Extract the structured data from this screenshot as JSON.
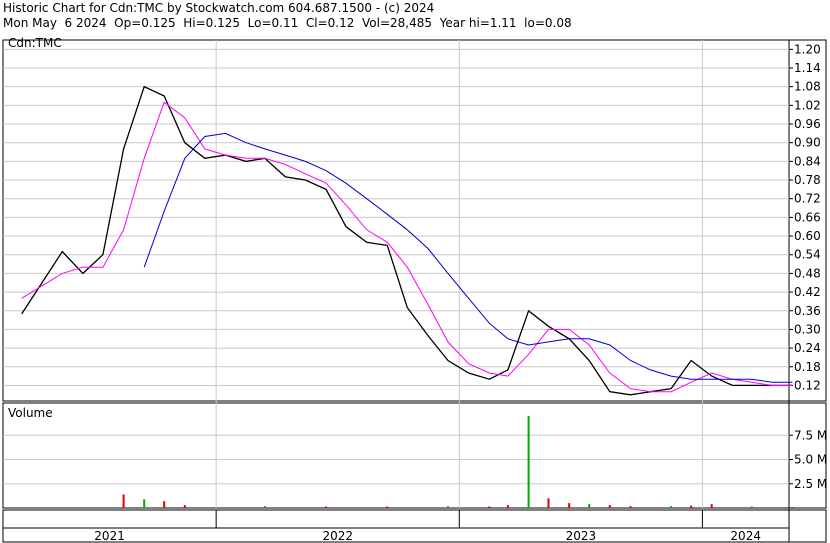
{
  "header": {
    "line1": "Historic Chart for Cdn:TMC by Stockwatch.com 604.687.1500 - (c) 2024",
    "line2": "Mon May  6 2024  Op=0.125  Hi=0.125  Lo=0.11  Cl=0.12  Vol=28,485  Year hi=1.11  lo=0.08"
  },
  "colors": {
    "price_bars": "#000000",
    "ma_short": "#ff00ff",
    "ma_long": "#0000cc",
    "volume_up": "#00aa00",
    "volume_down": "#dd0000",
    "grid": "#c8c8c8"
  },
  "chart_data": [
    {
      "type": "line",
      "label": "Cdn:TMC",
      "y_tick_labels": [
        "1.20",
        "1.14",
        "1.08",
        "1.02",
        "0.96",
        "0.90",
        "0.84",
        "0.78",
        "0.72",
        "0.66",
        "0.60",
        "0.54",
        "0.48",
        "0.42",
        "0.36",
        "0.30",
        "0.24",
        "0.18",
        "0.12"
      ],
      "ylim": [
        0.07,
        1.23
      ],
      "grid": true,
      "x": [
        "2021-03",
        "2021-05",
        "2021-06",
        "2021-07",
        "2021-08",
        "2021-09",
        "2021-10",
        "2021-11",
        "2021-12",
        "2022-01",
        "2022-02",
        "2022-03",
        "2022-04",
        "2022-05",
        "2022-06",
        "2022-07",
        "2022-08",
        "2022-09",
        "2022-10",
        "2022-11",
        "2022-12",
        "2023-01",
        "2023-02",
        "2023-03",
        "2023-04",
        "2023-05",
        "2023-06",
        "2023-07",
        "2023-08",
        "2023-09",
        "2023-10",
        "2023-11",
        "2023-12",
        "2024-01",
        "2024-02",
        "2024-03",
        "2024-04",
        "2024-05"
      ],
      "series": [
        {
          "values": [
            0.35,
            0.55,
            0.48,
            0.54,
            0.88,
            1.08,
            1.05,
            0.9,
            0.85,
            0.86,
            0.84,
            0.85,
            0.79,
            0.78,
            0.75,
            0.63,
            0.58,
            0.57,
            0.37,
            0.28,
            0.2,
            0.16,
            0.14,
            0.17,
            0.36,
            0.31,
            0.27,
            0.2,
            0.1,
            0.09,
            0.1,
            0.11,
            0.2,
            0.15,
            0.12,
            0.12,
            0.12,
            0.12
          ]
        },
        {
          "values": [
            0.4,
            0.48,
            0.5,
            0.5,
            0.62,
            0.85,
            1.03,
            0.98,
            0.88,
            0.86,
            0.85,
            0.85,
            0.83,
            0.8,
            0.77,
            0.7,
            0.62,
            0.58,
            0.5,
            0.38,
            0.26,
            0.19,
            0.16,
            0.15,
            0.22,
            0.3,
            0.3,
            0.25,
            0.16,
            0.11,
            0.1,
            0.1,
            0.13,
            0.16,
            0.14,
            0.13,
            0.12,
            0.12
          ]
        },
        {
          "values": [
            null,
            null,
            null,
            null,
            null,
            0.5,
            0.68,
            0.85,
            0.92,
            0.93,
            0.9,
            0.88,
            0.86,
            0.84,
            0.81,
            0.77,
            0.72,
            0.67,
            0.62,
            0.56,
            0.48,
            0.4,
            0.32,
            0.27,
            0.25,
            0.26,
            0.27,
            0.27,
            0.25,
            0.2,
            0.17,
            0.15,
            0.14,
            0.14,
            0.14,
            0.14,
            0.13,
            0.13
          ]
        }
      ]
    },
    {
      "type": "bar",
      "label": "Volume",
      "y_tick_labels": [
        "7.5 M",
        "5.0 M",
        "2.5 M"
      ],
      "ylim": [
        0,
        10
      ],
      "x": [
        "2021-08",
        "2021-09",
        "2021-10",
        "2021-11",
        "2022-03",
        "2022-06",
        "2022-09",
        "2022-12",
        "2023-02",
        "2023-03",
        "2023-04",
        "2023-05",
        "2023-06",
        "2023-07",
        "2023-08",
        "2023-09",
        "2023-11",
        "2023-12",
        "2024-01",
        "2024-03",
        "2024-05"
      ],
      "values": [
        1.4,
        0.9,
        0.7,
        0.3,
        0.2,
        0.15,
        0.15,
        0.2,
        0.15,
        0.3,
        9.5,
        1.0,
        0.5,
        0.4,
        0.3,
        0.2,
        0.2,
        0.25,
        0.4,
        0.15,
        0.1
      ],
      "x_tick_labels": [
        "2021",
        "2022",
        "2023",
        "2024"
      ]
    }
  ]
}
